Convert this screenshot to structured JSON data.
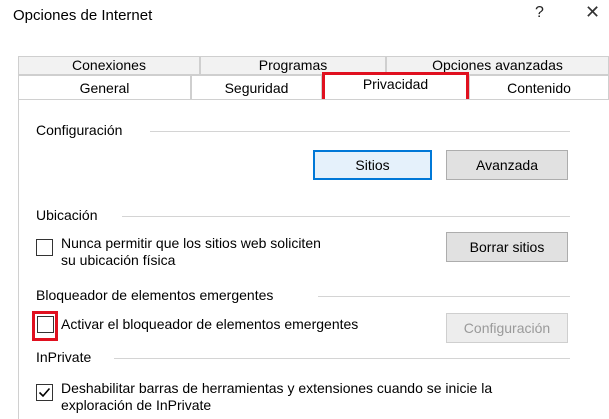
{
  "window": {
    "title": "Opciones de Internet",
    "help_glyph": "?",
    "close_glyph": "✕"
  },
  "tabs": {
    "back_row": [
      "Conexiones",
      "Programas",
      "Opciones avanzadas"
    ],
    "front_row": [
      "General",
      "Seguridad",
      "Privacidad",
      "Contenido"
    ],
    "active": "Privacidad"
  },
  "config": {
    "heading": "Configuración",
    "sites_button": "Sitios",
    "advanced_button": "Avanzada"
  },
  "location": {
    "heading": "Ubicación",
    "checkbox_line1": "Nunca permitir que los sitios web soliciten",
    "checkbox_line2": "su ubicación física",
    "checked": false,
    "clear_button": "Borrar sitios"
  },
  "popup": {
    "heading": "Bloqueador de elementos emergentes",
    "checkbox_label": "Activar el bloqueador de elementos emergentes",
    "checked": false,
    "settings_button": "Configuración"
  },
  "inprivate": {
    "heading": "InPrivate",
    "checkbox_line1": "Deshabilitar barras de herramientas y extensiones cuando se inicie la",
    "checkbox_line2": "exploración de InPrivate",
    "checked": true
  },
  "colors": {
    "highlight": "#e0101f",
    "focus_border": "#0078d7"
  }
}
